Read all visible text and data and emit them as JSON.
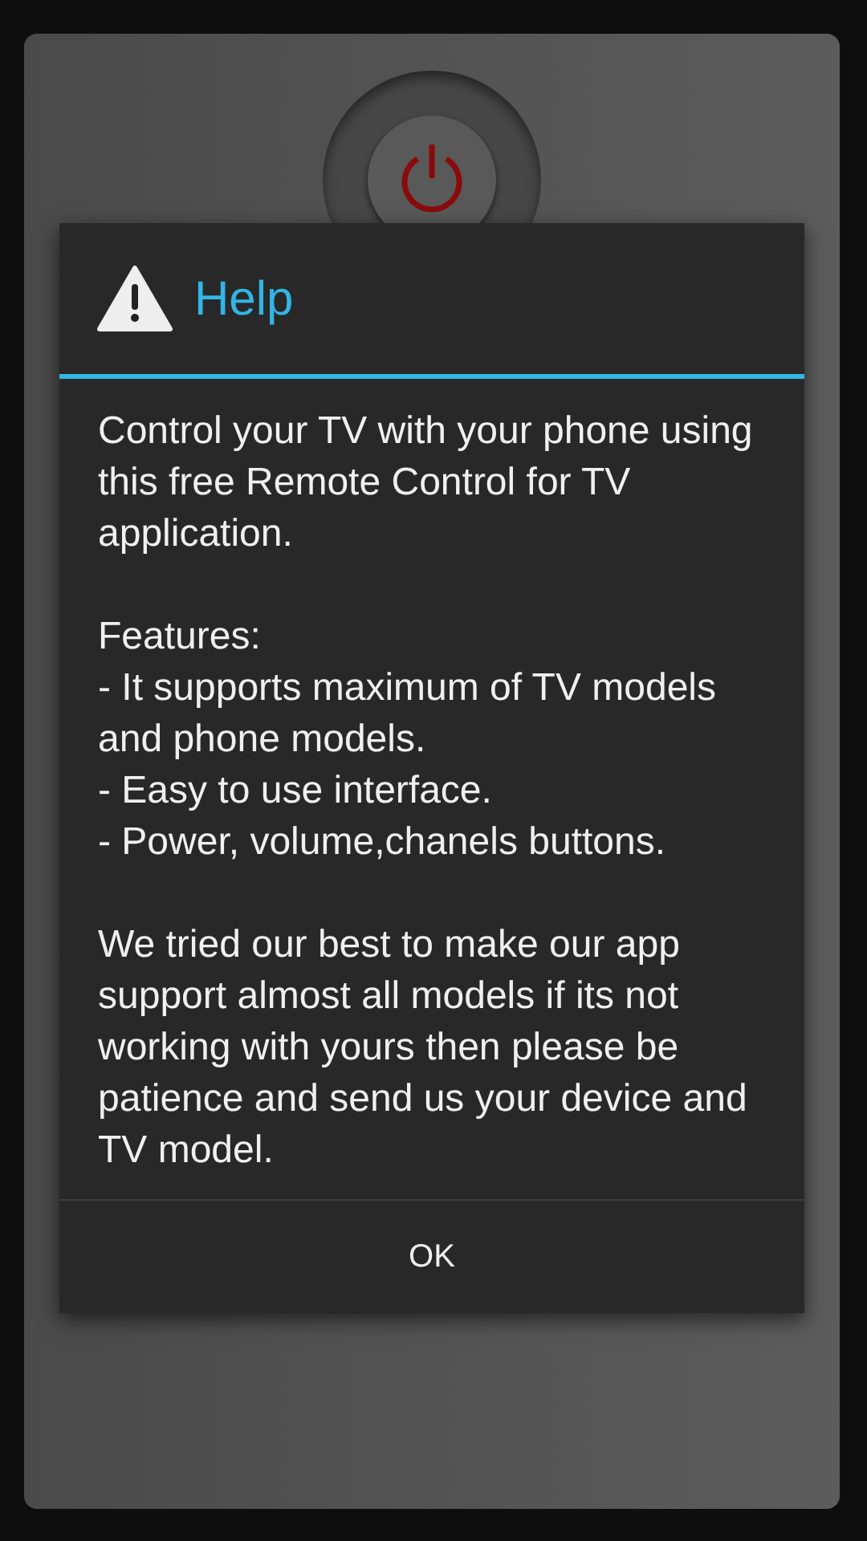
{
  "dialog": {
    "title": "Help",
    "paragraphs": [
      "Control your TV with your phone using this free Remote Control for TV application.",
      "Features:\n- It supports maximum of TV models and phone models.\n- Easy to use interface.\n- Power, volume,chanels buttons.",
      "We tried our best to make our app support almost all models if its not working with yours then please be patience and send us your device and TV model."
    ],
    "buttons": [
      "OK"
    ]
  }
}
